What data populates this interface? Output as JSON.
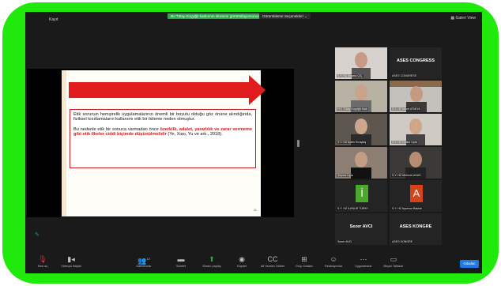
{
  "window": {
    "title": "Kayıt"
  },
  "top_bar": {
    "share_status": "Bu Tülay Koçyiğit kadınının ekranını görüntülüyorsunuz",
    "view_options": "Görüntüleme Seçenekleri",
    "gallery_view": "Galeri View"
  },
  "slide": {
    "paragraph1": "Etik sorunun hemşirelik uygulamalarının önemli bir boyutu olduğu göz önüne alındığında, fiziksel kısıtlamaların kullanımı etik bir ikileme neden olmuştur.",
    "paragraph2_plain": "Bu nedenle etik bir sonuca varmadan önce ",
    "paragraph2_red": "özerklik, adalet, yararlılık ve zarar vermeme gibi etik ilkeler ciddi biçimde düşünülmelidir",
    "paragraph2_citation": " (Ye, Xiao, Yu ve ark., 2018).",
    "page_number": "11"
  },
  "participants": [
    {
      "name": "S.Y. HZ Şeyma ÇİÇ",
      "label": ""
    },
    {
      "name": "ASES CONGRESS",
      "label": "ASES CONGRESS"
    },
    {
      "name": "H.Y. Tülay Koçyiğit Kadı",
      "label": ""
    },
    {
      "name": "S.Y. HZ Münir ATMIYA",
      "label": ""
    },
    {
      "name": "S.Y. HZ Ayten Kıraçtaş",
      "label": ""
    },
    {
      "name": "S.Y. HZ Hatice Uçta",
      "label": ""
    },
    {
      "name": "Şeyma Ugla",
      "label": ""
    },
    {
      "name": "S.Y. HZ Mehmet ASAS",
      "label": ""
    },
    {
      "name": "S.Y. HZ İLKNUR TÜRKY",
      "label": "İ"
    },
    {
      "name": "S.Y. HZ Aysenur Bakkal",
      "label": "A"
    },
    {
      "name": "Sezer AVCI",
      "label": "Sezer AVCI"
    },
    {
      "name": "ASES KONGRE",
      "label": "ASES KONGRE"
    }
  ],
  "toolbar": {
    "audio": "Sesi aç",
    "video": "Videoyu Başlat",
    "participants": "Katılımcılar",
    "participant_count": "12",
    "chat": "Sohbet",
    "share": "Ekranı paylaş",
    "record": "Kaydet",
    "cc": "Alt Yazıları Göster",
    "breakout": "Grup Odaları",
    "reactions": "Reaksiyonlar",
    "apps": "Uygulamalar",
    "whiteboard": "Beyaz Tahtalar",
    "leave": "Odadan"
  },
  "colors": {
    "frame_green": "#1fea0c",
    "slide_arrow": "#e01c1c",
    "share_badge": "#2fa64a",
    "leave_blue": "#1c7be5"
  }
}
